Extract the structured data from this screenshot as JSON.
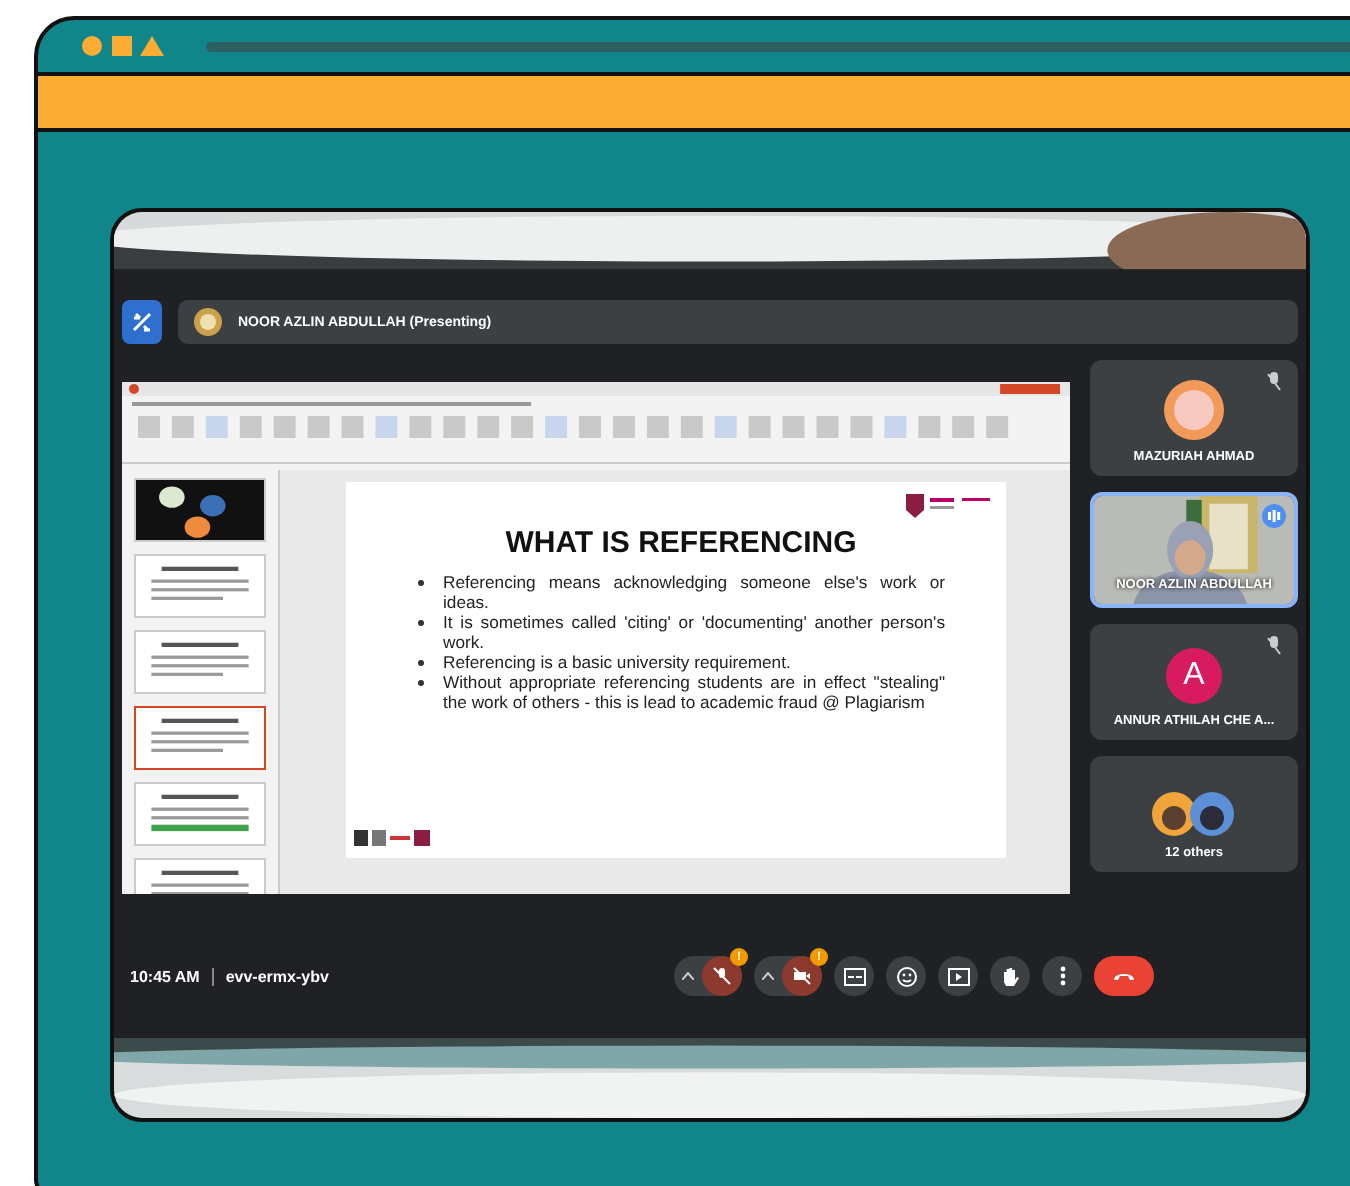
{
  "presenter": {
    "name": "NOOR AZLIN ABDULLAH (Presenting)"
  },
  "slide": {
    "title": "WHAT IS REFERENCING",
    "bullets": [
      "Referencing means acknowledging someone else's work or ideas.",
      "It is sometimes called 'citing' or 'documenting' another person's work.",
      "Referencing is a basic university requirement.",
      "Without appropriate referencing students are in effect \"stealing\" the work of others - this is lead to academic fraud @ Plagiarism"
    ]
  },
  "thumbnails": [
    {
      "selected": false
    },
    {
      "selected": false
    },
    {
      "selected": false
    },
    {
      "selected": true
    },
    {
      "selected": false
    },
    {
      "selected": false
    }
  ],
  "participants": [
    {
      "name": "MAZURIAH AHMAD",
      "muted": true,
      "selected": false
    },
    {
      "kind": "video",
      "name": "NOOR AZLIN ABDULLAH",
      "muted": false,
      "selected": true
    },
    {
      "kind": "letter",
      "initial": "A",
      "name": "ANNUR ATHILAH CHE A...",
      "muted": true,
      "selected": false
    },
    {
      "kind": "others",
      "name": "12 others",
      "muted": false,
      "selected": false
    }
  ],
  "bottom_bar": {
    "time": "10:45 AM",
    "meeting_code": "evv-ermx-ybv"
  },
  "controls": [
    {
      "kind": "mic",
      "off": true,
      "badge": "!"
    },
    {
      "kind": "camera",
      "off": true,
      "badge": "!"
    },
    {
      "kind": "captions"
    },
    {
      "kind": "emoji"
    },
    {
      "kind": "present"
    },
    {
      "kind": "hand"
    },
    {
      "kind": "more"
    },
    {
      "kind": "leave"
    }
  ]
}
